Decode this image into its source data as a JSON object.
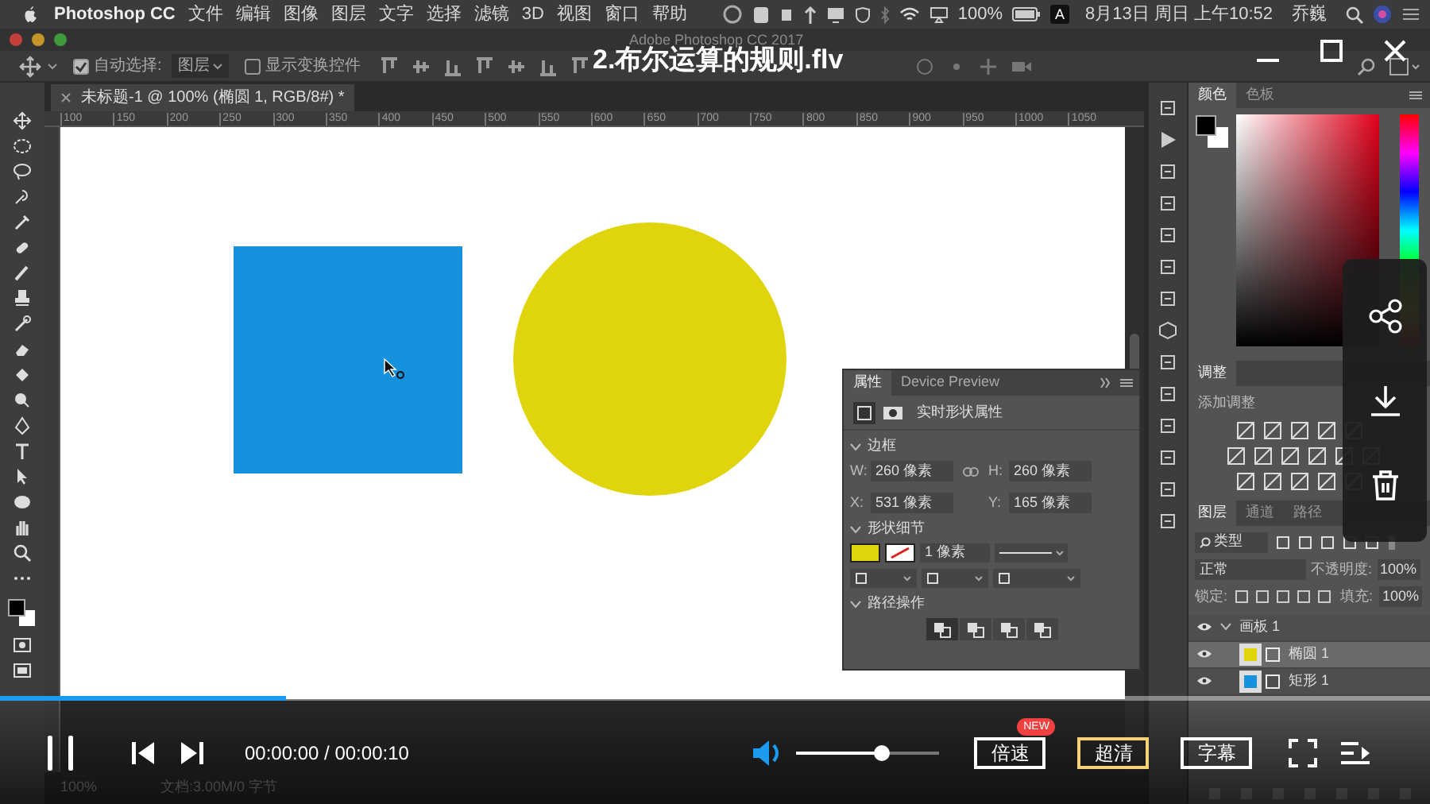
{
  "menu_bar": {
    "app": "Photoshop CC",
    "menus": [
      "文件",
      "编辑",
      "图像",
      "图层",
      "文字",
      "选择",
      "滤镜",
      "3D",
      "视图",
      "窗口",
      "帮助"
    ],
    "battery": "100%",
    "input_method": "A",
    "clock": "8月13日 周日 上午10:52",
    "user": "乔巍"
  },
  "window": {
    "title": "Adobe Photoshop CC 2017"
  },
  "options_bar": {
    "auto_select": {
      "label": "自动选择:",
      "checked": true
    },
    "auto_select_target": "图层",
    "show_transform": {
      "label": "显示变换控件",
      "checked": false
    }
  },
  "document_tab": {
    "label": "未标题-1 @ 100% (椭圆 1, RGB/8#) *"
  },
  "ruler": [
    "100",
    "150",
    "200",
    "250",
    "300",
    "350",
    "400",
    "450",
    "500",
    "550",
    "600",
    "650",
    "700",
    "750",
    "800",
    "850",
    "900",
    "950",
    "1000",
    "1050"
  ],
  "canvas": {
    "shapes": [
      {
        "kind": "rectangle"
      },
      {
        "kind": "ellipse"
      }
    ]
  },
  "properties_panel": {
    "tabs": [
      {
        "label": "属性",
        "selected": true
      },
      {
        "label": "Device Preview",
        "selected": false
      }
    ],
    "subtitle": "实时形状属性",
    "sections": [
      {
        "title": "边框",
        "expanded": true
      },
      {
        "title": "形状细节",
        "expanded": true
      },
      {
        "title": "路径操作",
        "expanded": true
      }
    ],
    "fields": [
      {
        "label": "W:",
        "value": "260 像素"
      },
      {
        "label": "H:",
        "value": "260 像素"
      },
      {
        "label": "X:",
        "value": "531 像素"
      },
      {
        "label": "Y:",
        "value": "165 像素"
      }
    ],
    "stroke_width": "1 像素"
  },
  "color_panel": {
    "tabs": [
      {
        "label": "颜色",
        "selected": true
      },
      {
        "label": "色板",
        "selected": false
      }
    ]
  },
  "adjustments_panel": {
    "tab": "调整",
    "label": "添加调整"
  },
  "layers_panel": {
    "tabs": [
      {
        "label": "图层",
        "selected": true
      },
      {
        "label": "通道",
        "selected": false
      },
      {
        "label": "路径",
        "selected": false
      }
    ],
    "filter": "类型",
    "blend_mode": "正常",
    "opacity_label": "不透明度:",
    "opacity": "100%",
    "lock_label": "锁定:",
    "fill_label": "填充:",
    "fill": "100%",
    "layers": [
      {
        "name": "画板 1",
        "visible": true,
        "expanded": true,
        "selected": false,
        "children": [
          {
            "name": "椭圆 1",
            "visible": true,
            "selected": true
          },
          {
            "name": "矩形 1",
            "visible": true,
            "selected": false
          }
        ]
      }
    ]
  },
  "status_bar": {
    "zoom": "100%",
    "document": "文档:3.00M/0 字节"
  },
  "player": {
    "title": "2.布尔运算的规则.flv",
    "playing": true,
    "progress": {
      "level": 0.2
    },
    "time": "00:00:00 / 00:00:10",
    "volume": {
      "level": 0.6
    },
    "buttons": [
      {
        "label": "倍速",
        "badge": "NEW",
        "highlighted": false
      },
      {
        "label": "超清",
        "highlighted": true
      },
      {
        "label": "字幕",
        "highlighted": false
      }
    ]
  }
}
